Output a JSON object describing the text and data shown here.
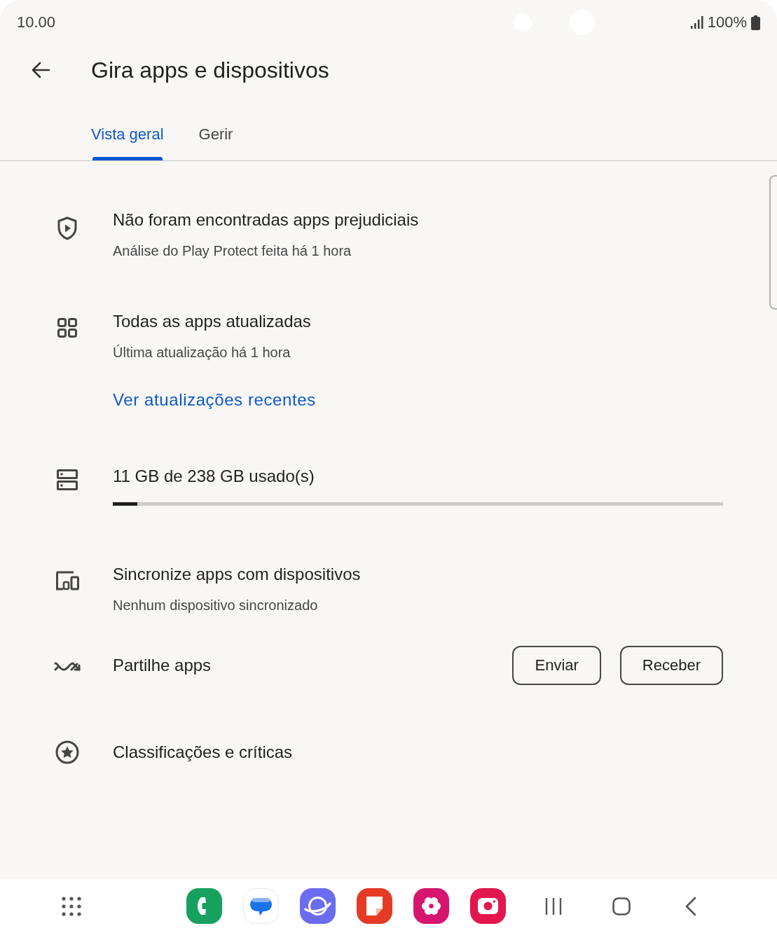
{
  "status_bar": {
    "time": "10.00",
    "battery": "100%"
  },
  "header": {
    "title": "Gira apps e dispositivos"
  },
  "tabs": [
    {
      "label": "Vista geral",
      "selected": true
    },
    {
      "label": "Gerir",
      "selected": false
    }
  ],
  "items": [
    {
      "kind": "status",
      "title": "Não foram encontradas apps prejudiciais",
      "subtitle": "Análise do Play Protect feita há 1 hora"
    },
    {
      "kind": "status",
      "title": "Todas as apps atualizadas",
      "subtitle": "Última atualização há 1 hora",
      "link": "Ver atualizações recentes"
    },
    {
      "kind": "storage",
      "title": "11 GB de 238 GB usado(s)",
      "level": 0.04
    },
    {
      "kind": "status",
      "title": "Sincronize apps com dispositivos",
      "subtitle": "Nenhum dispositivo sincronizado"
    },
    {
      "kind": "share",
      "title": "Partilhe apps",
      "buttons": [
        "Enviar",
        "Receber"
      ]
    },
    {
      "kind": "status",
      "title": "Classificações e críticas"
    }
  ]
}
